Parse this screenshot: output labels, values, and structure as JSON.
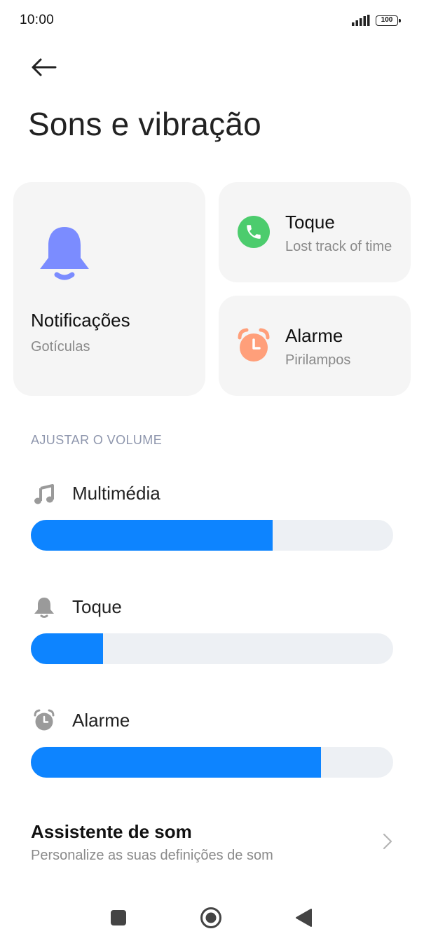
{
  "status_bar": {
    "time": "10:00",
    "battery": "100"
  },
  "header": {
    "back_icon": "arrow-left-icon",
    "title": "Sons e vibração"
  },
  "cards": {
    "notifications": {
      "title": "Notificações",
      "subtitle": "Gotículas",
      "icon": "bell-icon",
      "color": "#7b8cff"
    },
    "ringtone": {
      "title": "Toque",
      "subtitle": "Lost track of time",
      "icon": "phone-icon",
      "color": "#4ccc6d"
    },
    "alarm": {
      "title": "Alarme",
      "subtitle": "Pirilampos",
      "icon": "alarm-clock-icon",
      "color": "#ff9f7a"
    }
  },
  "volume_section": {
    "header": "AJUSTAR O VOLUME",
    "accent_color": "#0d84ff",
    "sliders": [
      {
        "label": "Multimédia",
        "icon": "music-note-icon",
        "level": 0.667
      },
      {
        "label": "Toque",
        "icon": "bell-icon",
        "level": 0.2
      },
      {
        "label": "Alarme",
        "icon": "alarm-clock-icon",
        "level": 0.8
      }
    ]
  },
  "assistant": {
    "title": "Assistente de som",
    "subtitle": "Personalize as suas definições de som"
  },
  "nav_bar": {
    "buttons": [
      "recents-square-icon",
      "home-circle-icon",
      "back-triangle-icon"
    ]
  }
}
